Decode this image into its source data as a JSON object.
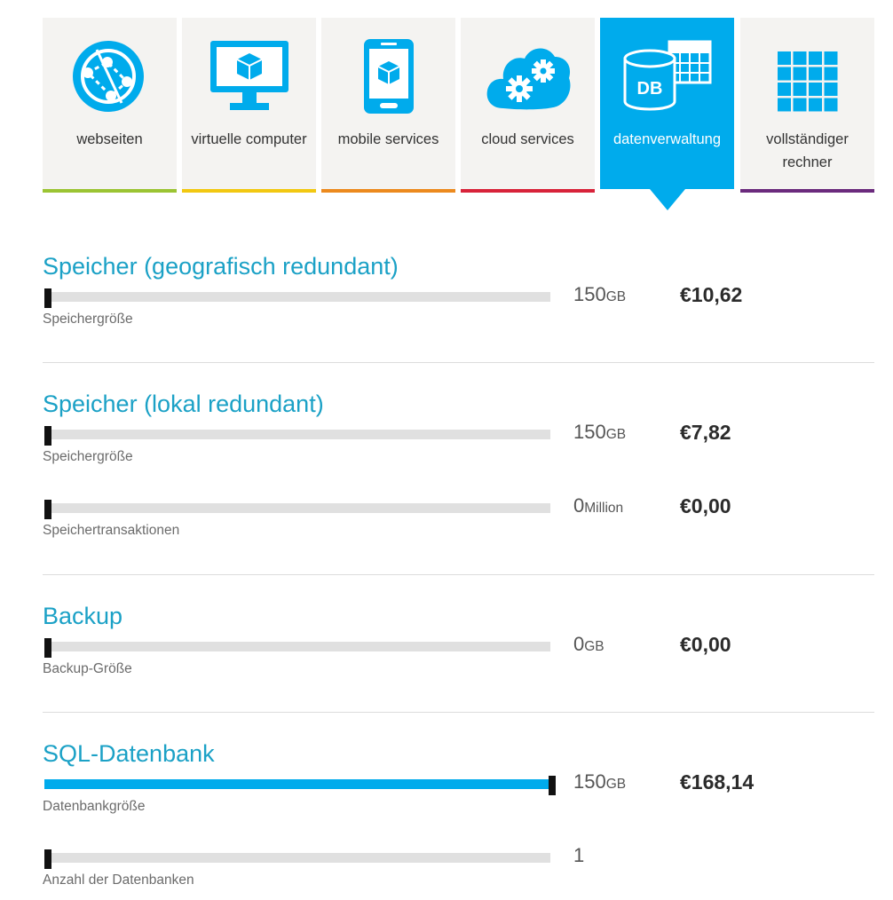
{
  "tabs": [
    {
      "label": "webseiten",
      "icon": "globe-icon",
      "underline_color": "#9bc433",
      "active": false
    },
    {
      "label": "virtuelle computer",
      "icon": "monitor-icon",
      "underline_color": "#f2c811",
      "active": false
    },
    {
      "label": "mobile services",
      "icon": "mobile-phone-icon",
      "underline_color": "#ec8a1e",
      "active": false
    },
    {
      "label": "cloud services",
      "icon": "cloud-gears-icon",
      "underline_color": "#d8233a",
      "active": false
    },
    {
      "label": "datenverwaltung",
      "icon": "database-icon",
      "underline_color": "#00abec",
      "active": true
    },
    {
      "label": "vollständiger rechner",
      "icon": "calculator-grid-icon",
      "underline_color": "#6b2a7d",
      "active": false
    }
  ],
  "accent_color": "#00abec",
  "sections": [
    {
      "title": "Speicher (geografisch redundant)",
      "rows": [
        {
          "label": "Speichergröße",
          "value": "150",
          "unit": "GB",
          "price": "€10,62",
          "level": 0
        }
      ]
    },
    {
      "title": "Speicher (lokal redundant)",
      "rows": [
        {
          "label": "Speichergröße",
          "value": "150",
          "unit": "GB",
          "price": "€7,82",
          "level": 0
        },
        {
          "label": "Speichertransaktionen",
          "value": "0",
          "unit": "Million",
          "price": "€0,00",
          "level": 0
        }
      ]
    },
    {
      "title": "Backup",
      "rows": [
        {
          "label": "Backup-Größe",
          "value": "0",
          "unit": "GB",
          "price": "€0,00",
          "level": 0
        }
      ]
    },
    {
      "title": "SQL-Datenbank",
      "rows": [
        {
          "label": "Datenbankgröße",
          "value": "150",
          "unit": "GB",
          "price": "€168,14",
          "level": 1
        },
        {
          "label": "Anzahl der Datenbanken",
          "value": "1",
          "unit": "",
          "price": "",
          "level": 0
        }
      ]
    }
  ]
}
